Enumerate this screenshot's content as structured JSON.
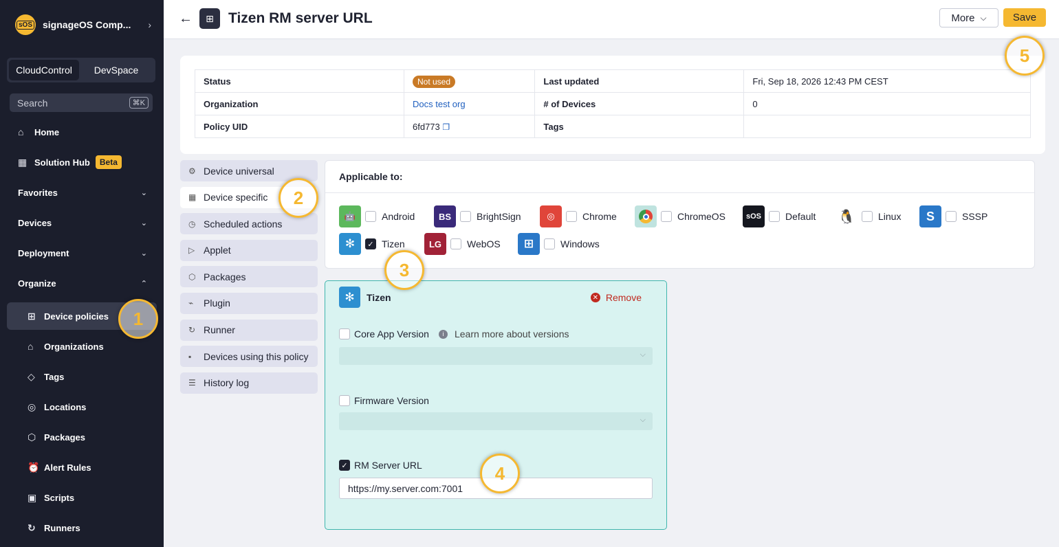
{
  "sidebar": {
    "org_name": "signageOS Comp...",
    "org_logo_text": "sOS",
    "switch": [
      "CloudControl",
      "DevSpace"
    ],
    "search_placeholder": "Search",
    "search_shortcut": "⌘K",
    "items": [
      {
        "label": "Home",
        "icon": "home-icon"
      },
      {
        "label": "Solution Hub",
        "icon": "grid-icon",
        "badge": "Beta"
      },
      {
        "label": "Favorites"
      },
      {
        "label": "Devices"
      },
      {
        "label": "Deployment"
      },
      {
        "label": "Organize"
      },
      {
        "label": "Device policies",
        "icon": "policy-icon"
      },
      {
        "label": "Organizations",
        "icon": "bank-icon"
      },
      {
        "label": "Tags",
        "icon": "tag-icon"
      },
      {
        "label": "Locations",
        "icon": "pin-icon"
      },
      {
        "label": "Packages",
        "icon": "package-icon"
      },
      {
        "label": "Alert Rules",
        "icon": "alarm-icon"
      },
      {
        "label": "Scripts",
        "icon": "terminal-icon"
      },
      {
        "label": "Runners",
        "icon": "refresh-icon"
      }
    ]
  },
  "header": {
    "title": "Tizen RM server URL",
    "more_label": "More",
    "save_label": "Save"
  },
  "info": {
    "status_label": "Status",
    "status_value": "Not used",
    "last_updated_label": "Last updated",
    "last_updated_value": "Fri, Sep 18, 2026 12:43 PM CEST",
    "org_label": "Organization",
    "org_value": "Docs test org",
    "devices_label": "# of Devices",
    "devices_value": "0",
    "uid_label": "Policy UID",
    "uid_value": "6fd773",
    "tags_label": "Tags",
    "tags_value": ""
  },
  "tabs": [
    "Device universal",
    "Device specific",
    "Scheduled actions",
    "Applet",
    "Packages",
    "Plugin",
    "Runner",
    "Devices using this policy",
    "History log"
  ],
  "applicable": {
    "title": "Applicable to:",
    "os": [
      {
        "label": "Android",
        "checked": false
      },
      {
        "label": "BrightSign",
        "checked": false
      },
      {
        "label": "Chrome",
        "checked": false
      },
      {
        "label": "ChromeOS",
        "checked": false
      },
      {
        "label": "Default",
        "checked": false
      },
      {
        "label": "Linux",
        "checked": false
      },
      {
        "label": "SSSP",
        "checked": false
      },
      {
        "label": "Tizen",
        "checked": true
      },
      {
        "label": "WebOS",
        "checked": false
      },
      {
        "label": "Windows",
        "checked": false
      }
    ]
  },
  "tizen_panel": {
    "title": "Tizen",
    "remove_label": "Remove",
    "core_app_label": "Core App Version",
    "learn_more": "Learn more about versions",
    "firmware_label": "Firmware Version",
    "rm_label": "RM Server URL",
    "rm_value": "https://my.server.com:7001"
  },
  "steps": [
    "1",
    "2",
    "3",
    "4",
    "5"
  ]
}
